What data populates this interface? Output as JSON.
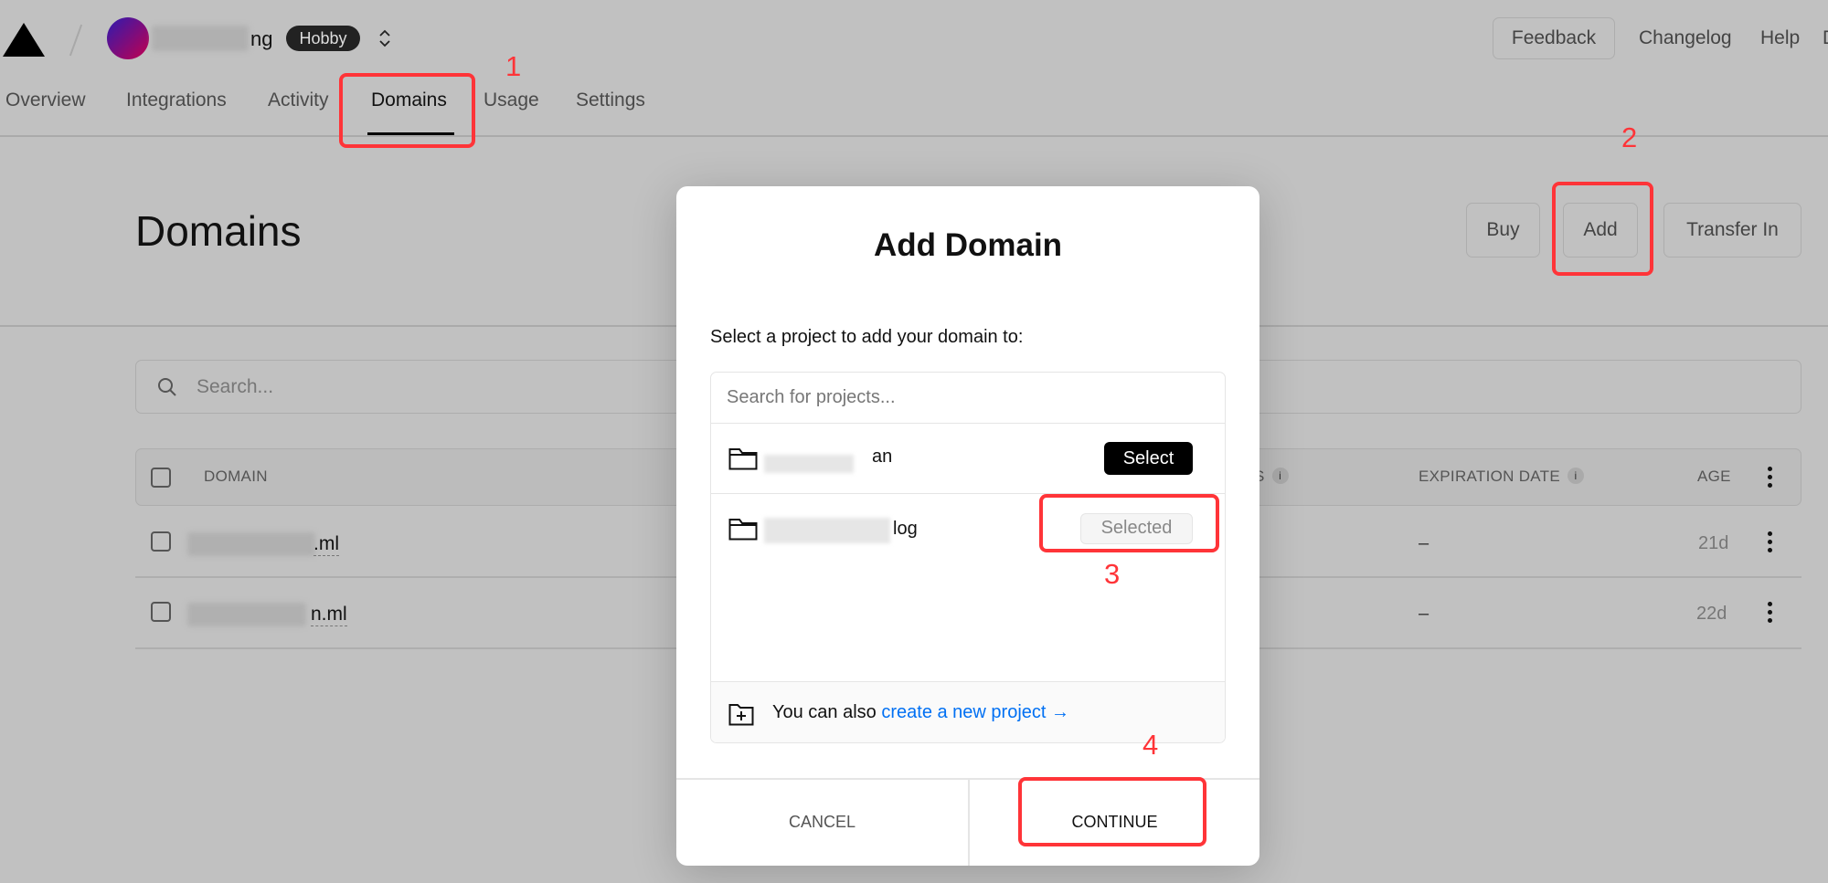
{
  "header": {
    "team_name_suffix": "ng",
    "plan_badge": "Hobby",
    "feedback": "Feedback",
    "changelog": "Changelog",
    "help": "Help",
    "cut_off": "D"
  },
  "tabs": [
    {
      "label": "Overview"
    },
    {
      "label": "Integrations"
    },
    {
      "label": "Activity"
    },
    {
      "label": "Domains",
      "active": true
    },
    {
      "label": "Usage"
    },
    {
      "label": "Settings"
    }
  ],
  "page": {
    "title": "Domains",
    "buy": "Buy",
    "add": "Add",
    "transfer": "Transfer In",
    "search_placeholder": "Search..."
  },
  "table": {
    "headers": {
      "domain": "DOMAIN",
      "partial": "S",
      "expiration": "EXPIRATION DATE",
      "age": "AGE"
    },
    "rows": [
      {
        "domain_suffix": ".ml",
        "expiration": "–",
        "age": "21d"
      },
      {
        "domain_suffix": "n.ml",
        "expiration": "–",
        "age": "22d"
      }
    ]
  },
  "modal": {
    "title": "Add Domain",
    "label": "Select a project to add your domain to:",
    "search_placeholder": "Search for projects...",
    "projects": [
      {
        "name_suffix": "an",
        "action": "Select",
        "selected": false
      },
      {
        "name_suffix": "log",
        "action": "Selected",
        "selected": true
      }
    ],
    "footer_text": "You can also ",
    "footer_link": "create a new project →",
    "cancel": "CANCEL",
    "continue": "CONTINUE"
  },
  "annotations": [
    "1",
    "2",
    "3",
    "4"
  ],
  "colors": {
    "annotation": "#ff3438",
    "link": "#0070f3",
    "overlay": "#c1c1c1"
  }
}
